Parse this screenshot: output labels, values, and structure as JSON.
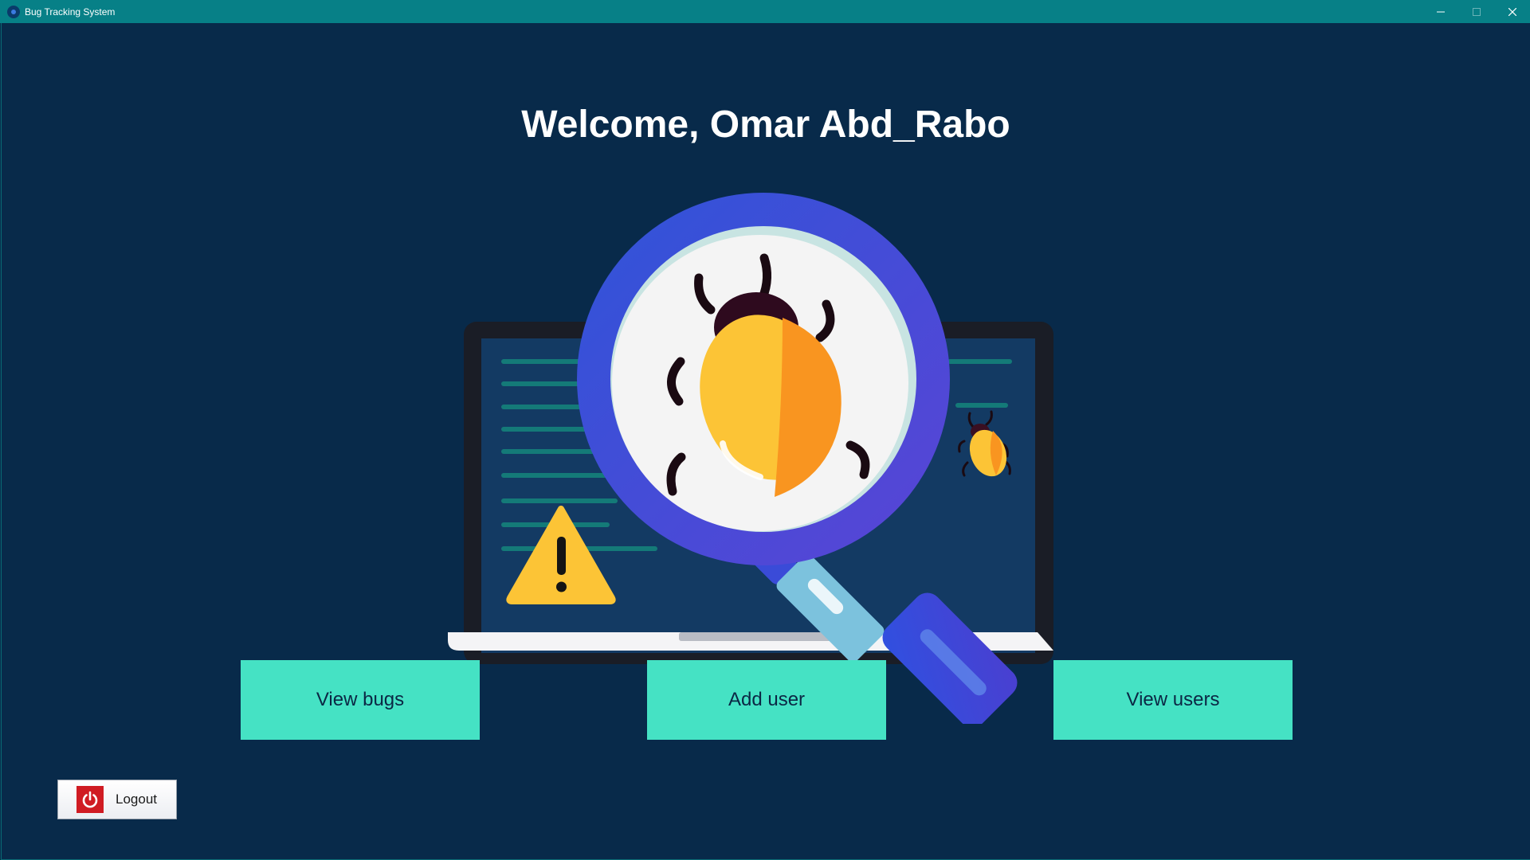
{
  "window": {
    "title": "Bug Tracking System",
    "controls": [
      "minimize-icon",
      "maximize-icon",
      "close-icon"
    ]
  },
  "main": {
    "welcome_text": "Welcome, Omar Abd_Rabo",
    "illustration_icon": "magnifier-bug-laptop-illustration"
  },
  "actions": {
    "view_bugs_label": "View bugs",
    "add_user_label": "Add user",
    "view_users_label": "View users"
  },
  "logout": {
    "label": "Logout",
    "icon": "power-icon"
  },
  "colors": {
    "titlebar": "#078087",
    "background": "#082a4a",
    "button": "#45e2c4",
    "button_text": "#0b2744",
    "logout_icon": "#d01c23"
  }
}
